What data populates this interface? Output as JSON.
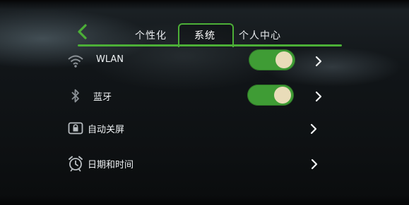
{
  "header": {
    "back_icon": "chevron-left-icon",
    "tabs": [
      {
        "label": "个性化",
        "active": false
      },
      {
        "label": "系统",
        "active": true
      },
      {
        "label": "个人中心",
        "active": false
      }
    ],
    "accent_color": "#4caf37"
  },
  "settings": {
    "items": [
      {
        "label": "WLAN",
        "icon": "wifi-icon",
        "toggle": "on"
      },
      {
        "label": "蓝牙",
        "icon": "bluetooth-icon",
        "toggle": "on"
      },
      {
        "label": "自动关屏",
        "icon": "lock-screen-icon"
      },
      {
        "label": "日期和时间",
        "icon": "alarm-clock-icon"
      }
    ],
    "toggle_on_color": "#3f9c35",
    "knob_color": "#e9dcb9"
  }
}
